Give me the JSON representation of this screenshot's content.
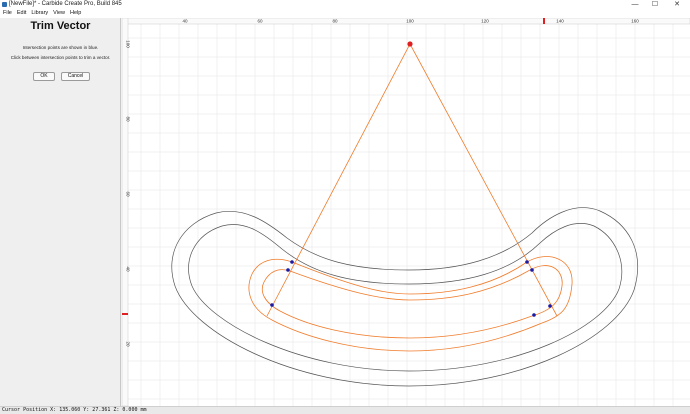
{
  "window": {
    "title": "[NewFile]* - Carbide Create Pro, Build 845",
    "controls": [
      "—",
      "☐",
      "✕"
    ]
  },
  "menu": [
    "File",
    "Edit",
    "Library",
    "View",
    "Help"
  ],
  "panel": {
    "heading": "Trim Vector",
    "line1": "Intersection points are shown in blue.",
    "line2": "Click between intersection points to trim a vector.",
    "ok_label": "OK",
    "cancel_label": "Cancel"
  },
  "ruler": {
    "x_ticks": [
      "40",
      "60",
      "80",
      "100",
      "120",
      "140",
      "160"
    ],
    "y_ticks": [
      "100",
      "80",
      "60",
      "40",
      "20"
    ]
  },
  "colors": {
    "geometry": "#555555",
    "selection": "#f07b2a",
    "intersection": "#1a1aa8",
    "grid": "#e6e6e6",
    "cursor_marker": "#e02020"
  },
  "status": {
    "text": "Cursor Position X: 135.060 Y: 27.361 Z: 0.000 mm"
  }
}
